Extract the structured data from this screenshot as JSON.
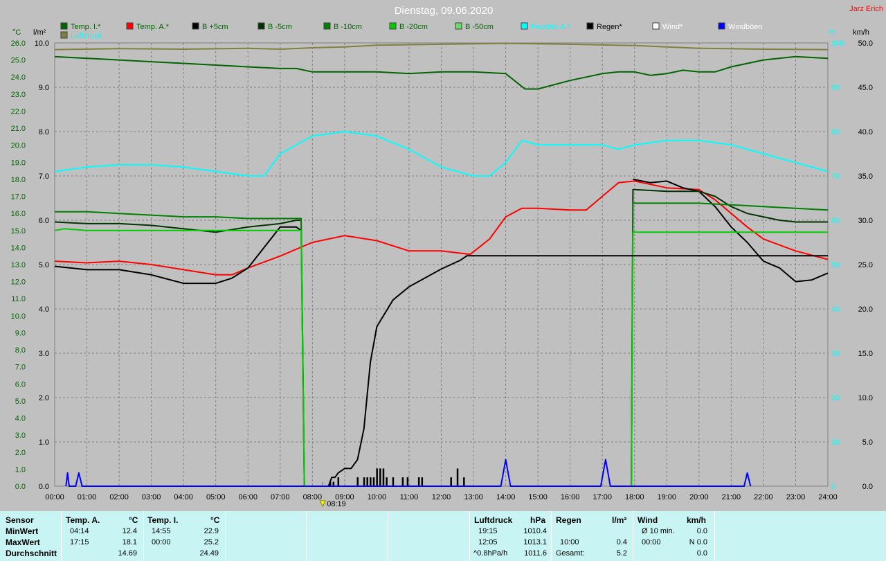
{
  "header": {
    "title": "Dienstag, 09.06.2020",
    "author": "Jarz Erich"
  },
  "legend": [
    {
      "label": "Temp. I.*",
      "color": "#006400",
      "text_color": "#006400"
    },
    {
      "label": "Temp. A.*",
      "color": "#ff0000",
      "text_color": "#006400"
    },
    {
      "label": "B +5cm",
      "color": "#000000",
      "text_color": "#006400"
    },
    {
      "label": "B -5cm",
      "color": "#003300",
      "text_color": "#006400"
    },
    {
      "label": "B -10cm",
      "color": "#008000",
      "text_color": "#006400"
    },
    {
      "label": "B -20cm",
      "color": "#00cc00",
      "text_color": "#006400"
    },
    {
      "label": "B -50cm",
      "color": "#66dd66",
      "text_color": "#006400"
    },
    {
      "label": "Feuchte A.*",
      "color": "#00ffff",
      "text_color": "#00ffff"
    },
    {
      "label": "Regen*",
      "color": "#000000",
      "text_color": "#000000"
    },
    {
      "label": "Wind*",
      "color": "#ffffff",
      "text_color": "#ffffff"
    },
    {
      "label": "Windböen",
      "color": "#0000ff",
      "text_color": "#ffffff"
    },
    {
      "label": "Luftdruck",
      "color": "#808040",
      "text_color": "#00ffff"
    }
  ],
  "chart_data": {
    "type": "line",
    "title": "Dienstag, 09.06.2020",
    "x_unit": "hours",
    "xlim": [
      0,
      24
    ],
    "x_tick_labels": [
      "00:00",
      "01:00",
      "02:00",
      "03:00",
      "04:00",
      "05:00",
      "06:00",
      "07:00",
      "08:00",
      "09:00",
      "10:00",
      "11:00",
      "12:00",
      "13:00",
      "14:00",
      "15:00",
      "16:00",
      "17:00",
      "18:00",
      "19:00",
      "20:00",
      "21:00",
      "22:00",
      "23:00",
      "24:00"
    ],
    "axes": {
      "temp": {
        "label": "°C",
        "ylim": [
          0,
          26
        ],
        "ticks": [
          "0.0",
          "1.0",
          "2.0",
          "3.0",
          "4.0",
          "5.0",
          "6.0",
          "7.0",
          "8.0",
          "9.0",
          "10.0",
          "11.0",
          "12.0",
          "13.0",
          "14.0",
          "15.0",
          "16.0",
          "17.0",
          "18.0",
          "19.0",
          "20.0",
          "21.0",
          "22.0",
          "23.0",
          "24.0",
          "25.0",
          "26.0"
        ]
      },
      "rain": {
        "label": "l/m²",
        "ylim": [
          0,
          10
        ],
        "ticks": [
          "0.0",
          "1.0",
          "2.0",
          "3.0",
          "4.0",
          "5.0",
          "6.0",
          "7.0",
          "8.0",
          "9.0",
          "10.0"
        ]
      },
      "humidity": {
        "label": "%",
        "ylim": [
          0,
          100
        ],
        "ticks": [
          "0",
          "10",
          "20",
          "30",
          "40",
          "50",
          "60",
          "70",
          "80",
          "90",
          "100"
        ]
      },
      "wind": {
        "label": "km/h",
        "ylim": [
          0,
          50
        ],
        "ticks": [
          "0.0",
          "5.0",
          "10.0",
          "15.0",
          "20.0",
          "25.0",
          "30.0",
          "35.0",
          "40.0",
          "45.0",
          "50.0"
        ]
      }
    },
    "grid": true,
    "series": [
      {
        "name": "Temp. I.*",
        "axis": "temp",
        "color": "#006400",
        "x": [
          0,
          1,
          2,
          3,
          4,
          5,
          6,
          7,
          7.5,
          8,
          9,
          10,
          11,
          12,
          13,
          14,
          14.6,
          15,
          16,
          17,
          17.5,
          18,
          18.5,
          19,
          19.5,
          20,
          20.5,
          21,
          22,
          23,
          24
        ],
        "y": [
          25.2,
          25.1,
          25.0,
          24.9,
          24.8,
          24.7,
          24.6,
          24.5,
          24.5,
          24.3,
          24.3,
          24.3,
          24.2,
          24.3,
          24.3,
          24.2,
          23.3,
          23.3,
          23.8,
          24.2,
          24.3,
          24.3,
          24.1,
          24.2,
          24.4,
          24.3,
          24.3,
          24.6,
          25.0,
          25.2,
          25.1
        ]
      },
      {
        "name": "Temp. A.*",
        "axis": "temp",
        "color": "#ff0000",
        "x": [
          0,
          1,
          2,
          3,
          4,
          5,
          5.5,
          6,
          7,
          8,
          9,
          10,
          11,
          12,
          12.9,
          13.5,
          14,
          14.5,
          15,
          16,
          16.5,
          17,
          17.5,
          18,
          19,
          20,
          20.5,
          21,
          21.5,
          22,
          23,
          24
        ],
        "y": [
          13.2,
          13.1,
          13.2,
          13.0,
          12.7,
          12.4,
          12.4,
          12.8,
          13.5,
          14.3,
          14.7,
          14.4,
          13.8,
          13.8,
          13.6,
          14.5,
          15.8,
          16.3,
          16.3,
          16.2,
          16.2,
          17.0,
          17.8,
          17.9,
          17.5,
          17.4,
          16.8,
          16.0,
          15.2,
          14.5,
          13.8,
          13.3
        ]
      },
      {
        "name": "B +5cm",
        "axis": "temp",
        "color": "#000000",
        "x": [
          0,
          1,
          2,
          3,
          4,
          5,
          5.5,
          6,
          6.5,
          7,
          7.5,
          7.65
        ],
        "y": [
          12.9,
          12.7,
          12.7,
          12.4,
          11.9,
          11.9,
          12.2,
          12.8,
          14.0,
          15.2,
          15.2,
          15.0
        ]
      },
      {
        "name": "B +5cm",
        "axis": "temp",
        "color": "#000000",
        "x": [
          17.95,
          18.5,
          19,
          19.5,
          20,
          20.5,
          21,
          21.5,
          22,
          22.5,
          23,
          23.5,
          24
        ],
        "y": [
          18.0,
          17.8,
          17.9,
          17.5,
          17.3,
          16.4,
          15.2,
          14.3,
          13.2,
          12.8,
          12.0,
          12.1,
          12.5
        ]
      },
      {
        "name": "B -5cm",
        "axis": "temp",
        "color": "#003300",
        "x": [
          0,
          1,
          2,
          3,
          4,
          5,
          6,
          7,
          7.5,
          7.65,
          7.75
        ],
        "y": [
          15.5,
          15.4,
          15.4,
          15.3,
          15.1,
          14.9,
          15.2,
          15.4,
          15.6,
          15.6,
          0.0
        ]
      },
      {
        "name": "B -5cm",
        "axis": "temp",
        "color": "#003300",
        "x": [
          17.9,
          17.95,
          18,
          19,
          20,
          20.5,
          21,
          21.5,
          22,
          22.5,
          23,
          24
        ],
        "y": [
          0.0,
          17.4,
          17.4,
          17.3,
          17.3,
          17.0,
          16.4,
          16.0,
          15.8,
          15.6,
          15.5,
          15.5
        ]
      },
      {
        "name": "B -10cm",
        "axis": "temp",
        "color": "#008000",
        "x": [
          0,
          1,
          2,
          3,
          4,
          5,
          6,
          7,
          7.5,
          7.65,
          7.75
        ],
        "y": [
          16.1,
          16.1,
          16.0,
          15.9,
          15.8,
          15.8,
          15.7,
          15.7,
          15.7,
          15.7,
          0.0
        ]
      },
      {
        "name": "B -10cm",
        "axis": "temp",
        "color": "#008000",
        "x": [
          17.9,
          17.95,
          18,
          19,
          20,
          21,
          22,
          23,
          24
        ],
        "y": [
          0.0,
          16.6,
          16.6,
          16.6,
          16.6,
          16.5,
          16.4,
          16.3,
          16.2
        ]
      },
      {
        "name": "B -20cm",
        "axis": "temp",
        "color": "#00cc00",
        "x": [
          0,
          0.3,
          1,
          2,
          3,
          4,
          5,
          6,
          7,
          7.5,
          7.65,
          7.75
        ],
        "y": [
          15.0,
          15.1,
          15.0,
          15.0,
          15.0,
          15.0,
          15.0,
          15.0,
          15.0,
          15.0,
          15.0,
          0.0
        ]
      },
      {
        "name": "B -20cm",
        "axis": "temp",
        "color": "#00cc00",
        "x": [
          17.9,
          17.95,
          18,
          19,
          20,
          21,
          22,
          23,
          24
        ],
        "y": [
          0.0,
          14.9,
          14.9,
          14.9,
          14.9,
          14.9,
          14.9,
          14.9,
          14.9
        ]
      },
      {
        "name": "Feuchte A.*",
        "axis": "humidity",
        "color": "#00ffff",
        "x": [
          0,
          1,
          2,
          3,
          4,
          5,
          6,
          6.5,
          7,
          8,
          9,
          10,
          11,
          12,
          13,
          13.5,
          14,
          14.5,
          15,
          16,
          16.5,
          17,
          17.5,
          18,
          19,
          20,
          21,
          22,
          23,
          24
        ],
        "y": [
          71,
          72,
          72.5,
          72.5,
          72,
          71,
          70,
          70,
          75,
          79,
          80,
          79,
          76,
          72,
          70,
          70,
          73,
          78,
          77,
          77,
          77,
          77,
          76,
          77,
          78,
          78,
          77,
          75,
          73,
          71
        ]
      },
      {
        "name": "Luftdruck",
        "axis": "humidity",
        "color": "#808040",
        "x": [
          0,
          2,
          4,
          6,
          7,
          8,
          9,
          10,
          14,
          16,
          18,
          20,
          22,
          24
        ],
        "y": [
          98.5,
          98.7,
          98.6,
          98.8,
          98.6,
          98.9,
          99.1,
          99.5,
          99.9,
          99.7,
          99.4,
          98.8,
          98.6,
          98.5
        ]
      },
      {
        "name": "Regen*",
        "axis": "rain",
        "color": "#000000",
        "x": [
          8.5,
          8.55,
          8.6,
          8.7,
          8.8,
          9,
          9.2,
          9.4,
          9.6,
          9.8,
          10,
          10.5,
          11,
          12,
          12.3,
          12.6,
          12.8,
          13.5,
          14,
          24
        ],
        "y": [
          0,
          0.1,
          0.2,
          0.2,
          0.3,
          0.4,
          0.4,
          0.6,
          1.3,
          2.8,
          3.6,
          4.2,
          4.5,
          4.9,
          5.0,
          5.1,
          5.2,
          5.2,
          5.2,
          5.2
        ]
      },
      {
        "name": "Windböen",
        "axis": "wind",
        "color": "#0000ff",
        "x": [
          0.35,
          0.4,
          0.45,
          0.65,
          0.75,
          0.85,
          13.85,
          14,
          14.15,
          16.95,
          17.1,
          17.25,
          21.4,
          21.5,
          21.6
        ],
        "y": [
          0,
          1.5,
          0,
          0,
          1.5,
          0,
          0,
          3.0,
          0,
          0,
          3.0,
          0,
          0,
          1.5,
          0
        ]
      }
    ],
    "rain_bars": [
      {
        "x": 8.55,
        "value": 0.1
      },
      {
        "x": 8.65,
        "value": 0.1
      },
      {
        "x": 8.8,
        "value": 0.2
      },
      {
        "x": 9.4,
        "value": 0.2
      },
      {
        "x": 9.6,
        "value": 0.2
      },
      {
        "x": 9.7,
        "value": 0.2
      },
      {
        "x": 9.8,
        "value": 0.2
      },
      {
        "x": 9.9,
        "value": 0.2
      },
      {
        "x": 10.0,
        "value": 0.4
      },
      {
        "x": 10.1,
        "value": 0.4
      },
      {
        "x": 10.2,
        "value": 0.4
      },
      {
        "x": 10.3,
        "value": 0.2
      },
      {
        "x": 10.5,
        "value": 0.2
      },
      {
        "x": 10.8,
        "value": 0.2
      },
      {
        "x": 10.95,
        "value": 0.2
      },
      {
        "x": 11.3,
        "value": 0.2
      },
      {
        "x": 11.4,
        "value": 0.2
      },
      {
        "x": 12.3,
        "value": 0.2
      },
      {
        "x": 12.5,
        "value": 0.4
      },
      {
        "x": 12.7,
        "value": 0.2
      }
    ],
    "sunrise_marker": {
      "x": 8.32,
      "label": "08:19"
    }
  },
  "stats": {
    "sensor_label": "Sensor",
    "min_label": "MinWert",
    "max_label": "MaxWert",
    "avg_label": "Durchschnitt",
    "temp_a": {
      "title": "Temp. A.",
      "unit": "°C",
      "min_time": "04:14",
      "min": "12.4",
      "max_time": "17:15",
      "max": "18.1",
      "avg": "14.69"
    },
    "temp_i": {
      "title": "Temp. I.",
      "unit": "°C",
      "min_time": "14:55",
      "min": "22.9",
      "max_time": "00:00",
      "max": "25.2",
      "avg": "24.49"
    },
    "pressure": {
      "title": "Luftdruck",
      "unit": "hPa",
      "min_time": "19:15",
      "min": "1010.4",
      "max_time": "12:05",
      "max": "1013.1",
      "trend": "^0.8hPa/h",
      "avg": "1011.6"
    },
    "rain": {
      "title": "Regen",
      "unit": "l/m²",
      "max_time": "10:00",
      "max": "0.4",
      "total_label": "Gesamt:",
      "total": "5.2"
    },
    "wind": {
      "title": "Wind",
      "unit": "km/h",
      "avg_label": "Ø 10 min.",
      "avg10": "0.0",
      "max_time": "00:00",
      "max": "N 0.0",
      "avg": "0.0"
    }
  }
}
